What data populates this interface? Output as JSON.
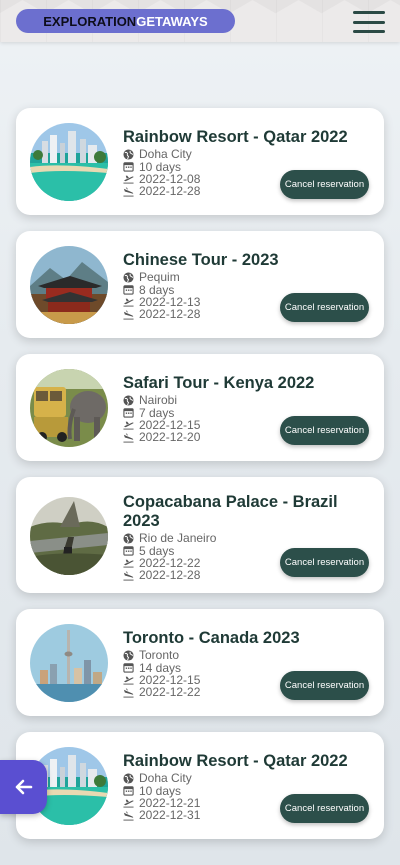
{
  "header": {
    "brand_part1": "EXPLORATION",
    "brand_part2": "GETAWAYS",
    "menu_icon": "hamburger-icon",
    "brand_color": "#6c6fcf"
  },
  "reservations": [
    {
      "title": "Rainbow Resort - Qatar 2022",
      "location": "Doha City",
      "duration": "10 days",
      "departure": "2022-12-08",
      "arrival": "2022-12-28",
      "cancel_label": "Cancel reservation"
    },
    {
      "title": "Chinese Tour - 2023",
      "location": "Pequim",
      "duration": "8 days",
      "departure": "2022-12-13",
      "arrival": "2022-12-28",
      "cancel_label": "Cancel reservation"
    },
    {
      "title": "Safari Tour - Kenya 2022",
      "location": "Nairobi",
      "duration": "7 days",
      "departure": "2022-12-15",
      "arrival": "2022-12-20",
      "cancel_label": "Cancel reservation"
    },
    {
      "title": "Copacabana Palace - Brazil 2023",
      "location": "Rio de Janeiro",
      "duration": "5 days",
      "departure": "2022-12-22",
      "arrival": "2022-12-28",
      "cancel_label": "Cancel reservation"
    },
    {
      "title": "Toronto - Canada 2023",
      "location": "Toronto",
      "duration": "14 days",
      "departure": "2022-12-15",
      "arrival": "2022-12-22",
      "cancel_label": "Cancel reservation"
    },
    {
      "title": "Rainbow Resort - Qatar 2022",
      "location": "Doha City",
      "duration": "10 days",
      "departure": "2022-12-21",
      "arrival": "2022-12-31",
      "cancel_label": "Cancel reservation"
    }
  ],
  "icons": {
    "location": "globe-icon",
    "duration": "calendar-icon",
    "departure": "plane-takeoff-icon",
    "arrival": "plane-landing-icon",
    "back": "arrow-left-icon"
  },
  "colors": {
    "accent": "#2c4f4a",
    "back_button": "#5a4fd1"
  }
}
